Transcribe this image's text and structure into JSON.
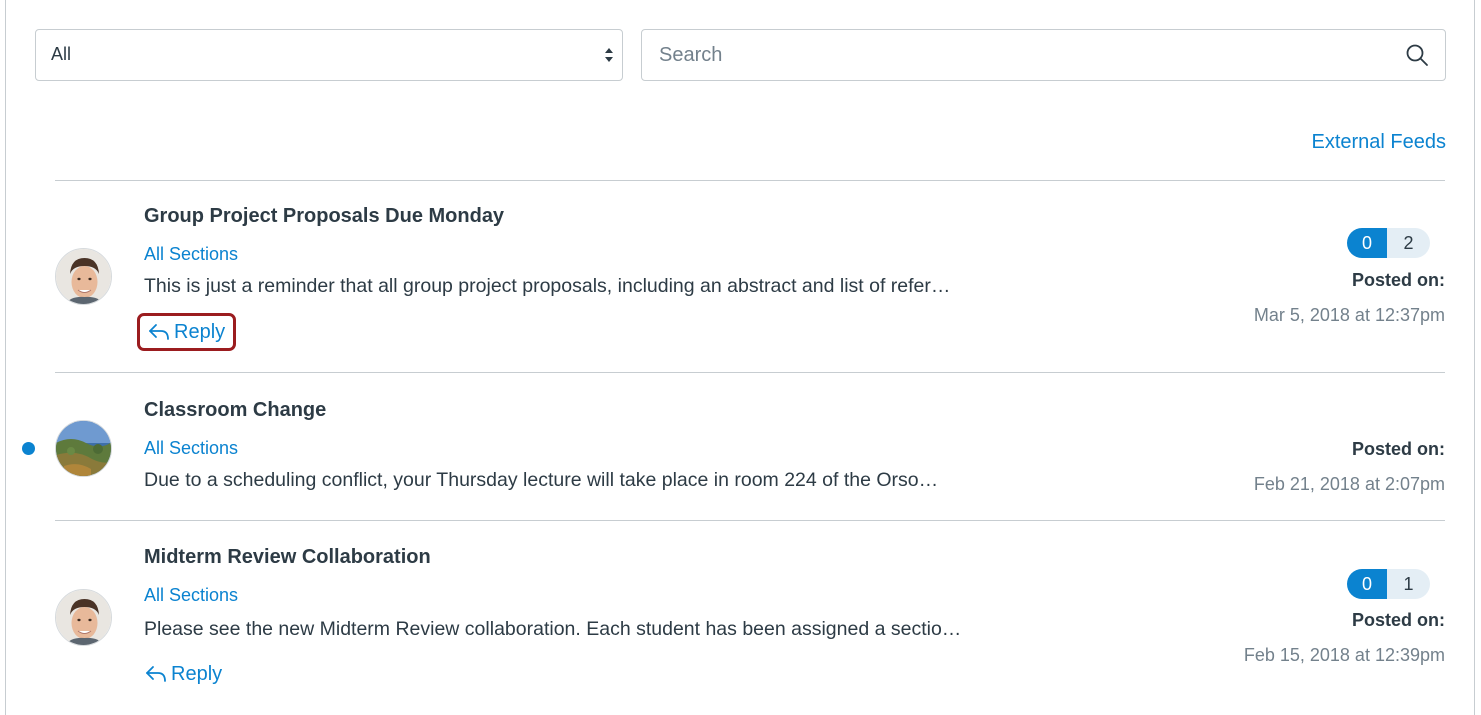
{
  "filter": {
    "selected": "All"
  },
  "search": {
    "placeholder": "Search"
  },
  "external_feeds_label": "External Feeds",
  "announcements": [
    {
      "title": "Group Project Proposals Due Monday",
      "sections": "All Sections",
      "excerpt": "This is just a reminder that all group project proposals, including an abstract and list of refer…",
      "reply_label": "Reply",
      "unread_count": "0",
      "total_count": "2",
      "posted_label": "Posted on:",
      "posted_date": "Mar 5, 2018 at 12:37pm",
      "avatar_icon": "student-avatar-icon",
      "unread": false
    },
    {
      "title": "Classroom Change",
      "sections": "All Sections",
      "excerpt": "Due to a scheduling conflict, your Thursday lecture will take place in room 224 of the Orso…",
      "posted_label": "Posted on:",
      "posted_date": "Feb 21, 2018 at 2:07pm",
      "avatar_icon": "landscape-avatar-icon",
      "unread": true
    },
    {
      "title": "Midterm Review Collaboration",
      "sections": "All Sections",
      "excerpt": "Please see the new Midterm Review collaboration. Each student has been assigned a sectio…",
      "reply_label": "Reply",
      "unread_count": "0",
      "total_count": "1",
      "posted_label": "Posted on:",
      "posted_date": "Feb 15, 2018 at 12:39pm",
      "avatar_icon": "student-avatar-icon",
      "unread": false
    }
  ],
  "colors": {
    "link": "#0b83d0",
    "text": "#2d3b45",
    "muted": "#73818c",
    "highlight": "#9b1c1f"
  }
}
